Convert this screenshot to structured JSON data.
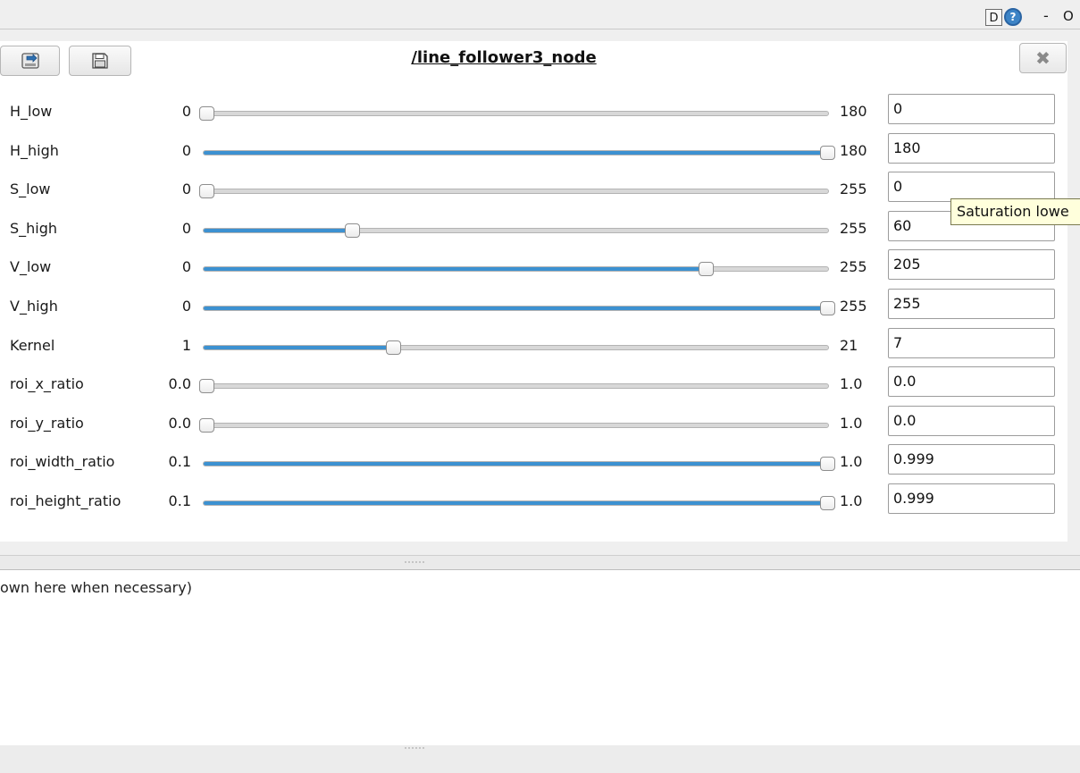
{
  "window": {
    "d_label": "D",
    "help_label": "?",
    "minimize_label": "-",
    "maximize_label": "O"
  },
  "node": {
    "title": "/line_follower3_node",
    "close_label": "✖"
  },
  "params": [
    {
      "name": "H_low",
      "min": "0",
      "max": "180",
      "value": "0",
      "fraction": 0.0
    },
    {
      "name": "H_high",
      "min": "0",
      "max": "180",
      "value": "180",
      "fraction": 1.0
    },
    {
      "name": "S_low",
      "min": "0",
      "max": "255",
      "value": "0",
      "fraction": 0.0
    },
    {
      "name": "S_high",
      "min": "0",
      "max": "255",
      "value": "60",
      "fraction": 0.235
    },
    {
      "name": "V_low",
      "min": "0",
      "max": "255",
      "value": "205",
      "fraction": 0.804
    },
    {
      "name": "V_high",
      "min": "0",
      "max": "255",
      "value": "255",
      "fraction": 1.0
    },
    {
      "name": "Kernel",
      "min": "1",
      "max": "21",
      "value": "7",
      "fraction": 0.3
    },
    {
      "name": "roi_x_ratio",
      "min": "0.0",
      "max": "1.0",
      "value": "0.0",
      "fraction": 0.0
    },
    {
      "name": "roi_y_ratio",
      "min": "0.0",
      "max": "1.0",
      "value": "0.0",
      "fraction": 0.0
    },
    {
      "name": "roi_width_ratio",
      "min": "0.1",
      "max": "1.0",
      "value": "0.999",
      "fraction": 1.0
    },
    {
      "name": "roi_height_ratio",
      "min": "0.1",
      "max": "1.0",
      "value": "0.999",
      "fraction": 1.0
    }
  ],
  "tooltip": {
    "text": "Saturation lowe"
  },
  "log": {
    "text": "own here when necessary)"
  },
  "colors": {
    "slider_fill": "#3c91d1",
    "tooltip_bg": "#ffffdc"
  },
  "icons": {
    "load": "load-icon",
    "save": "save-icon",
    "close": "close-icon",
    "help": "help-icon"
  }
}
